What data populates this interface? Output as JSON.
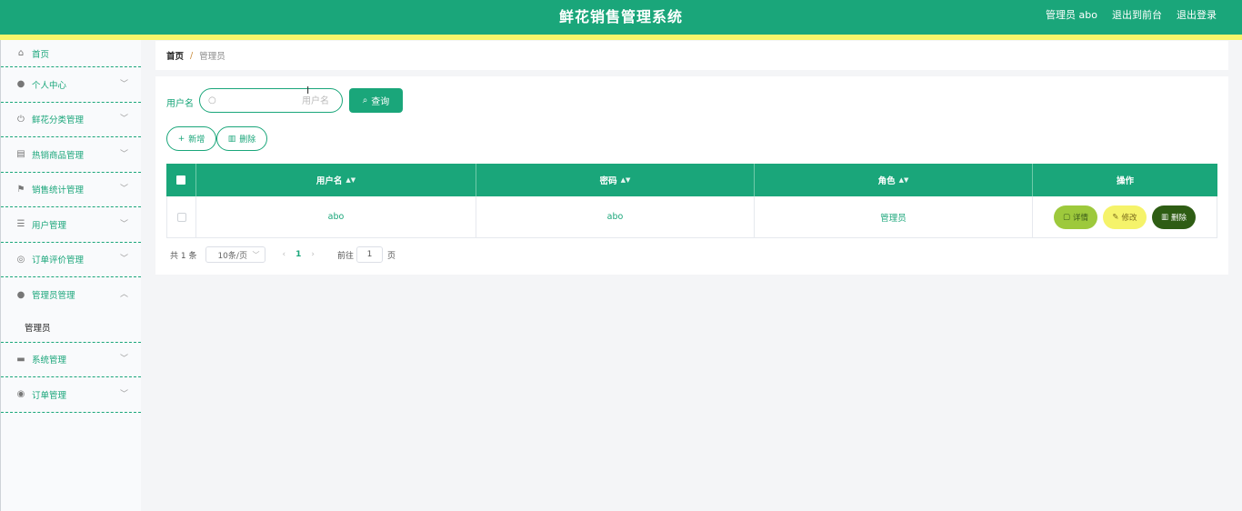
{
  "header": {
    "title": "鲜花销售管理系统",
    "user_label": "管理员 abo",
    "to_front": "退出到前台",
    "logout": "退出登录",
    "color_primary": "#1aa67a",
    "color_strip": "#f7f56b"
  },
  "sidebar": {
    "items": [
      {
        "label": "首页",
        "icon": "home-icon"
      },
      {
        "label": "个人中心",
        "icon": "user-icon"
      },
      {
        "label": "鲜花分类管理",
        "icon": "power-icon"
      },
      {
        "label": "热销商品管理",
        "icon": "clipboard-icon"
      },
      {
        "label": "销售统计管理",
        "icon": "flag-icon"
      },
      {
        "label": "用户管理",
        "icon": "list-icon"
      },
      {
        "label": "订单评价管理",
        "icon": "compass-icon"
      },
      {
        "label": "管理员管理",
        "icon": "user-icon"
      },
      {
        "label": "系统管理",
        "icon": "printer-icon"
      },
      {
        "label": "订单管理",
        "icon": "support-icon"
      }
    ],
    "submenu_admin": "管理员"
  },
  "breadcrumb": {
    "home": "首页",
    "separator": "/",
    "current": "管理员"
  },
  "search": {
    "label": "用户名",
    "placeholder": "用户名",
    "value": "",
    "query_label": "查询"
  },
  "actions": {
    "add_label": "新增",
    "delete_label": "删除"
  },
  "table": {
    "headers": [
      "用户名",
      "密码",
      "角色",
      "操作"
    ],
    "rows": [
      {
        "username": "abo",
        "password": "abo",
        "role": "管理员"
      }
    ],
    "row_actions": {
      "detail": "详情",
      "edit": "修改",
      "delete": "删除"
    }
  },
  "pagination": {
    "total": "共 1 条",
    "page_size": "10条/页",
    "current_page": "1",
    "goto_label": "前往",
    "goto_value": "1",
    "page_suffix": "页"
  }
}
